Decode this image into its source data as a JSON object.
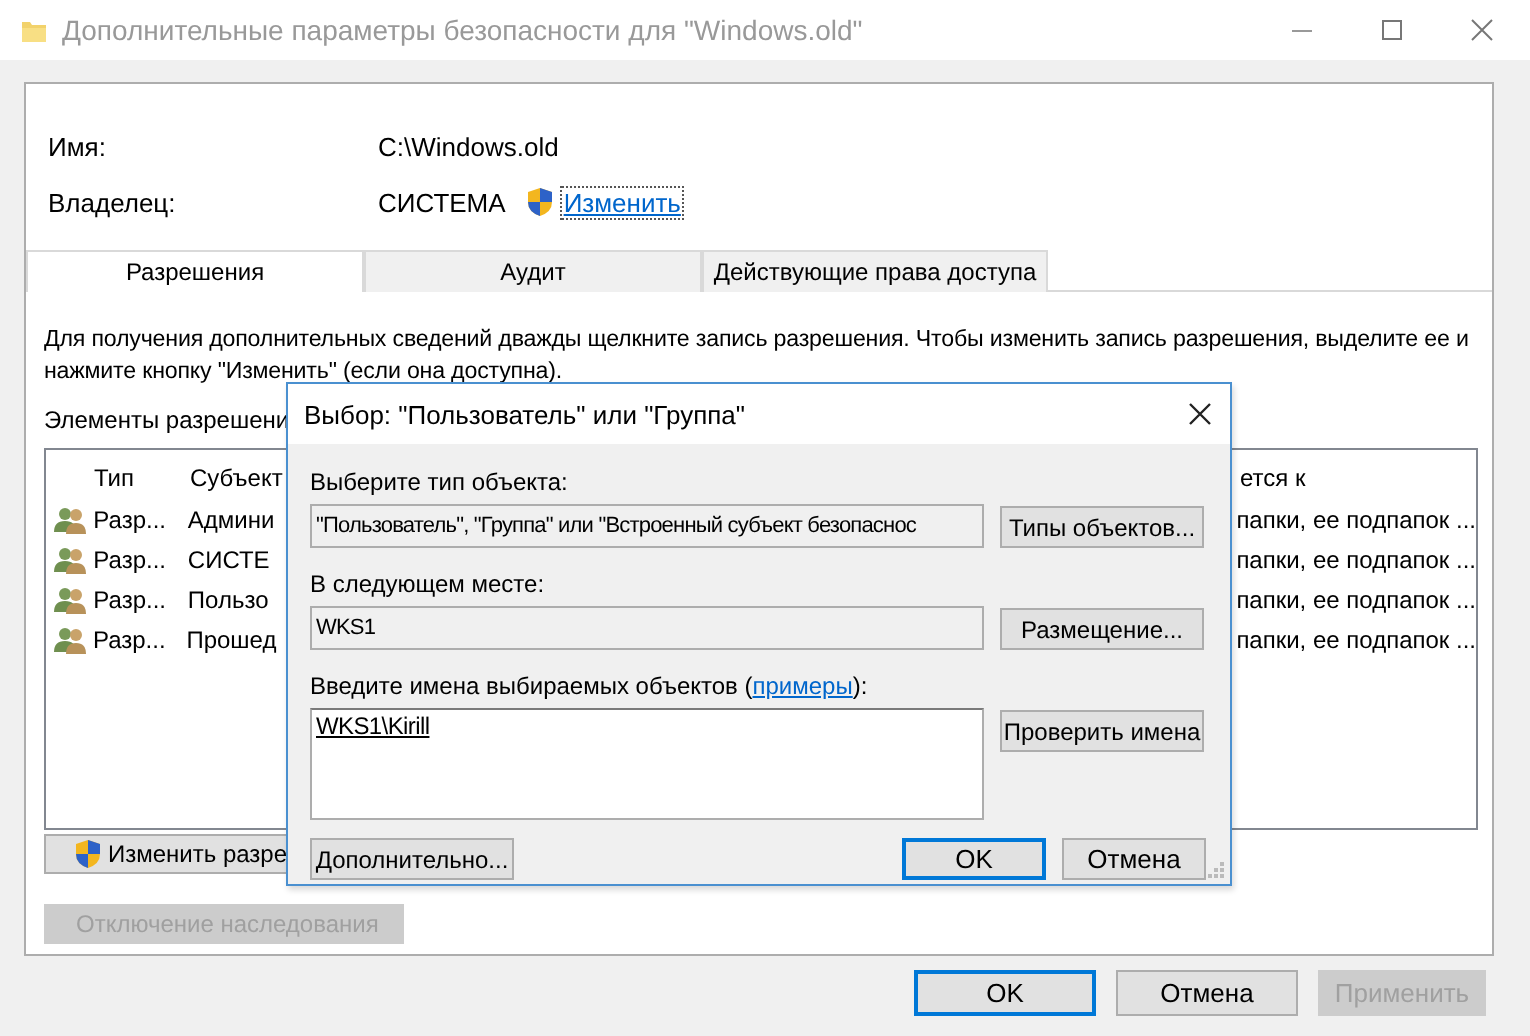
{
  "window": {
    "title": "Дополнительные параметры безопасности  для \"Windows.old\""
  },
  "info": [
    {
      "label": "Имя:",
      "value": "C:\\Windows.old"
    },
    {
      "label": "Владелец:",
      "value": "СИСТЕМА",
      "link": "Изменить"
    }
  ],
  "tabs": [
    {
      "label": "Разрешения",
      "selected": true
    },
    {
      "label": "Аудит",
      "selected": false
    },
    {
      "label": "Действующие права доступа",
      "selected": false
    }
  ],
  "description": "Для получения дополнительных сведений дважды щелкните запись разрешения. Чтобы изменить запись разрешения, выделите ее и нажмите кнопку \"Изменить\" (если она доступна).",
  "list_label": "Элементы разрешени",
  "permissions": {
    "columns": [
      "Тип",
      "Субъект",
      "ется к"
    ],
    "rows": [
      {
        "type": "Разр...",
        "subject": "Админи",
        "applies": "папки, ее подпапок ..."
      },
      {
        "type": "Разр...",
        "subject": "СИСТЕ",
        "applies": "папки, ее подпапок ..."
      },
      {
        "type": "Разр...",
        "subject": "Пользо",
        "applies": "папки, ее подпапок ..."
      },
      {
        "type": "Разр...",
        "subject": "Прошед",
        "applies": "папки, ее подпапок ..."
      }
    ]
  },
  "panel_buttons": [
    {
      "label": "Изменить разре",
      "shield": true,
      "disabled": false
    },
    {
      "label": "Отключение наследования",
      "shield": false,
      "disabled": true
    }
  ],
  "dialog": {
    "title": "Выбор: \"Пользователь\" или \"Группа\"",
    "sections": [
      {
        "kind": "field",
        "label": "Выберите тип объекта:",
        "value": "\"Пользователь\", \"Группа\" или \"Встроенный субъект безопаснос",
        "button": "Типы объектов..."
      },
      {
        "kind": "field",
        "label": "В следующем месте:",
        "value": "WKS1",
        "button": "Размещение..."
      },
      {
        "kind": "names",
        "label": "Введите имена выбираемых объектов (",
        "link": "примеры",
        "label_end": "):",
        "value": "WKS1\\Kirill",
        "button": "Проверить имена"
      }
    ],
    "advanced_button": "Дополнительно...",
    "buttons": [
      {
        "label": "OK",
        "default": true
      },
      {
        "label": "Отмена",
        "default": false
      }
    ]
  },
  "buttons": [
    {
      "label": "OK",
      "default": true,
      "disabled": false
    },
    {
      "label": "Отмена",
      "default": false,
      "disabled": false
    },
    {
      "label": "Применить",
      "default": false,
      "disabled": true
    }
  ]
}
